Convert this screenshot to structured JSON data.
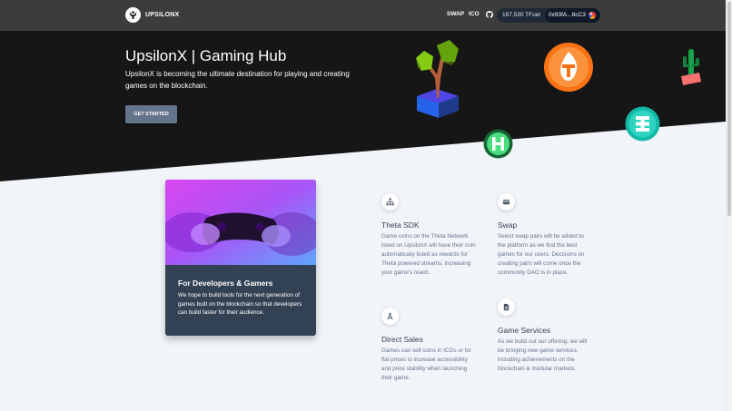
{
  "navbar": {
    "brand_name": "UPSILONX",
    "links": {
      "swap": "SWAP",
      "ico": "ICO"
    },
    "wallet": {
      "balance": "167.530 TFuel",
      "address": "0x93fA...8cC3"
    },
    "icons": [
      "upsilon-logo",
      "github-icon",
      "wallet-avatar"
    ]
  },
  "hero": {
    "title": "UpsilonX | Gaming Hub",
    "description": "UpsilonX is becoming the ultimate destination for playing and creating games on the blockchain.",
    "cta_label": "GET STARTED",
    "decorations": [
      "tree-3d",
      "tfuel-coin",
      "theta-coin",
      "hcoin",
      "cactus-3d"
    ]
  },
  "feature_card": {
    "title": "For Developers & Gamers",
    "text": "We hope to build tools for the next generation of games built on the blockchain so that developers can build faster for their audience."
  },
  "services": [
    {
      "icon": "sitemap-icon",
      "title": "Theta SDK",
      "text": "Game coins on the Theta Network listed on UpsilonX will have their coin automatically listed as rewards for Theta powered streams, increasing your game's reach."
    },
    {
      "icon": "card-icon",
      "title": "Swap",
      "text": "Select swap pairs will be added to the platform as we find the best games for our users. Decisions on creating pairs will come once the community DAO is in place."
    },
    {
      "icon": "compass-icon",
      "title": "Direct Sales",
      "text": "Games can sell coins in ICOs or for flat prices to increase accessibility and price stability when launching their game."
    },
    {
      "icon": "file-icon",
      "title": "Game Services",
      "text": "As we build out our offering, we will be bringing new game services, including achievements on the blockchain & modular markets."
    }
  ],
  "colors": {
    "navbar": "#3c3c3c",
    "hero": "#161616",
    "card": "#334155",
    "button": "#64748b",
    "page": "#f1f5f9"
  }
}
